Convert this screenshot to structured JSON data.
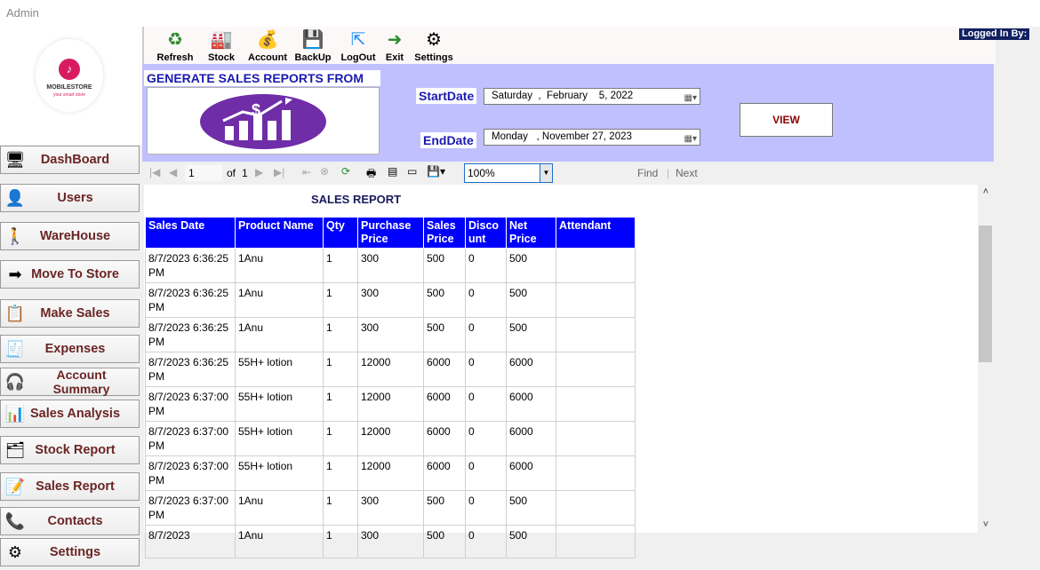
{
  "window": {
    "title": "Admin"
  },
  "logo": {
    "mark": "♪",
    "name": "MOBILESTORE",
    "tagline": "your smart store"
  },
  "toolbar": {
    "items": [
      {
        "label": "Refresh",
        "icon": "refresh-icon"
      },
      {
        "label": "Stock",
        "icon": "stock-icon"
      },
      {
        "label": "Account",
        "icon": "account-icon"
      },
      {
        "label": "BackUp",
        "icon": "backup-icon"
      },
      {
        "label": "LogOut",
        "icon": "logout-icon"
      },
      {
        "label": "Exit",
        "icon": "exit-icon"
      },
      {
        "label": "Settings",
        "icon": "settings-gear-icon"
      }
    ],
    "logged_in_label": "Logged In By:"
  },
  "sidebar": {
    "items": [
      {
        "label": "DashBoard",
        "icon": "dashboard-icon"
      },
      {
        "label": "Users",
        "icon": "users-icon"
      },
      {
        "label": "WareHouse",
        "icon": "warehouse-icon"
      },
      {
        "label": "Move To Store",
        "icon": "move-to-store-icon"
      },
      {
        "label": "Make Sales",
        "icon": "make-sales-icon"
      },
      {
        "label": "Expenses",
        "icon": "expenses-icon"
      },
      {
        "label": "Account Summary",
        "icon": "account-summary-icon"
      },
      {
        "label": "Sales Analysis",
        "icon": "sales-analysis-icon"
      },
      {
        "label": "Stock Report",
        "icon": "stock-report-icon"
      },
      {
        "label": "Sales Report",
        "icon": "sales-report-icon"
      },
      {
        "label": "Contacts",
        "icon": "contacts-icon"
      },
      {
        "label": "Settings",
        "icon": "settings-icon"
      }
    ]
  },
  "filter": {
    "title": "GENERATE SALES REPORTS FROM",
    "start_label": "StartDate",
    "start_value": "Saturday  ,  February    5, 2022",
    "end_label": "EndDate",
    "end_value": "Monday   , November 27, 2023",
    "view_label": "VIEW"
  },
  "report_toolbar": {
    "page": "1",
    "of_label": "of",
    "total_pages": "1",
    "zoom": "100%",
    "find_label": "Find",
    "next_label": "Next"
  },
  "report": {
    "title": "SALES REPORT",
    "columns": [
      "Sales Date",
      "Product Name",
      "Qty",
      "Purchase Price",
      "Sales Price",
      "Disco unt",
      "Net Price",
      "Attendant"
    ],
    "rows": [
      [
        "8/7/2023 6:36:25 PM",
        "1Anu",
        "1",
        "300",
        "500",
        "0",
        "500",
        ""
      ],
      [
        "8/7/2023 6:36:25 PM",
        "1Anu",
        "1",
        "300",
        "500",
        "0",
        "500",
        ""
      ],
      [
        "8/7/2023 6:36:25 PM",
        "1Anu",
        "1",
        "300",
        "500",
        "0",
        "500",
        ""
      ],
      [
        "8/7/2023 6:36:25 PM",
        "55H+ lotion",
        "1",
        "12000",
        "6000",
        "0",
        "6000",
        ""
      ],
      [
        "8/7/2023 6:37:00 PM",
        "55H+ lotion",
        "1",
        "12000",
        "6000",
        "0",
        "6000",
        ""
      ],
      [
        "8/7/2023 6:37:00 PM",
        "55H+ lotion",
        "1",
        "12000",
        "6000",
        "0",
        "6000",
        ""
      ],
      [
        "8/7/2023 6:37:00 PM",
        "55H+ lotion",
        "1",
        "12000",
        "6000",
        "0",
        "6000",
        ""
      ],
      [
        "8/7/2023 6:37:00 PM",
        "1Anu",
        "1",
        "300",
        "500",
        "0",
        "500",
        ""
      ],
      [
        "8/7/2023",
        "1Anu",
        "1",
        "300",
        "500",
        "0",
        "500",
        ""
      ]
    ]
  },
  "colors": {
    "header_blue": "#0000ff",
    "panel_lavender": "#c0c0ff",
    "label_blue": "#1a1ab0",
    "sidebar_text": "#6b2525"
  }
}
